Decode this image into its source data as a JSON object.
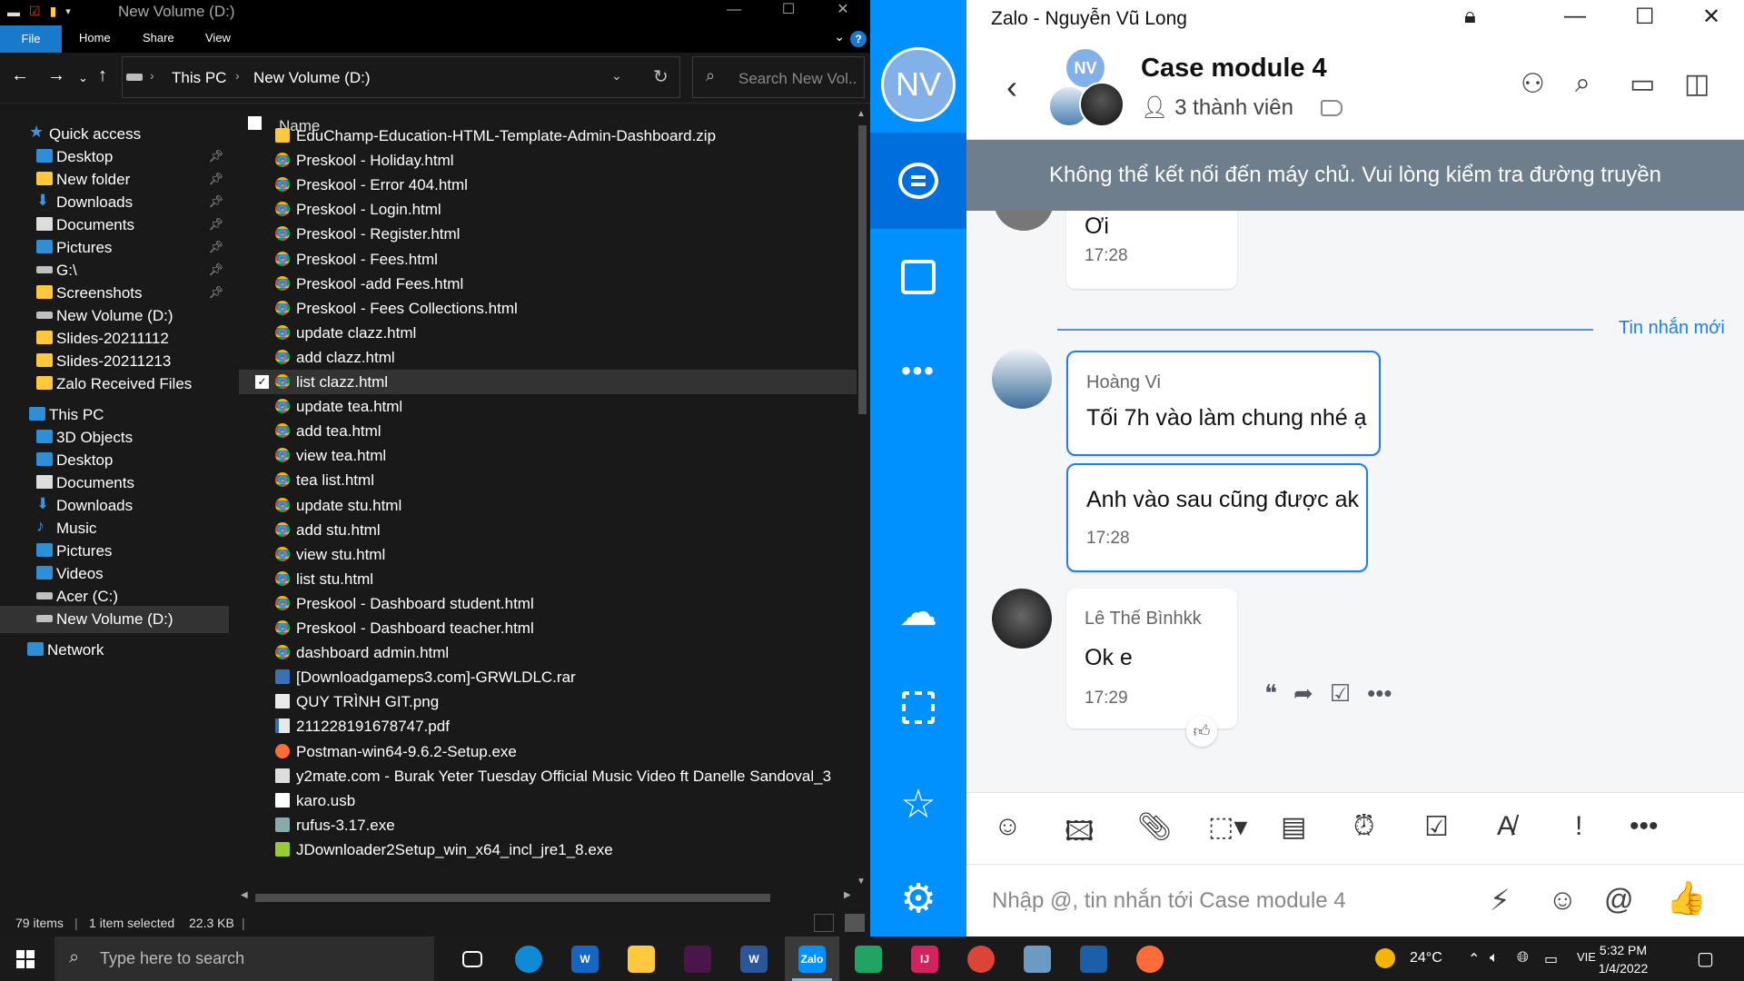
{
  "explorer": {
    "title": "New Volume (D:)",
    "ribbon_tabs": [
      "File",
      "Home",
      "Share",
      "View"
    ],
    "help_label": "?",
    "breadcrumb": [
      "This PC",
      "New Volume (D:)"
    ],
    "search_placeholder": "Search New Vol...",
    "nav": [
      {
        "label": "Quick access",
        "icon": "star-icon"
      },
      {
        "label": "Desktop",
        "icon": "desktop-icon",
        "pinned": true
      },
      {
        "label": "New folder",
        "icon": "folder-icon",
        "pinned": true
      },
      {
        "label": "Downloads",
        "icon": "download-arrow-icon",
        "pinned": true
      },
      {
        "label": "Documents",
        "icon": "documents-icon",
        "pinned": true
      },
      {
        "label": "Pictures",
        "icon": "pictures-icon",
        "pinned": true
      },
      {
        "label": "G:\\",
        "icon": "drive-icon",
        "pinned": true
      },
      {
        "label": "Screenshots",
        "icon": "folder-icon",
        "pinned": true
      },
      {
        "label": "New Volume (D:)",
        "icon": "drive-icon"
      },
      {
        "label": "Slides-20211112",
        "icon": "folder-icon"
      },
      {
        "label": "Slides-20211213",
        "icon": "folder-icon"
      },
      {
        "label": "Zalo Received Files",
        "icon": "folder-icon"
      },
      {
        "label": "This PC",
        "icon": "pc-icon"
      },
      {
        "label": "3D Objects",
        "icon": "3d-objects-icon"
      },
      {
        "label": "Desktop",
        "icon": "desktop-icon"
      },
      {
        "label": "Documents",
        "icon": "documents-icon"
      },
      {
        "label": "Downloads",
        "icon": "download-arrow-icon"
      },
      {
        "label": "Music",
        "icon": "music-icon"
      },
      {
        "label": "Pictures",
        "icon": "pictures-icon"
      },
      {
        "label": "Videos",
        "icon": "videos-icon"
      },
      {
        "label": "Acer (C:)",
        "icon": "drive-icon"
      },
      {
        "label": "New Volume (D:)",
        "icon": "drive-icon",
        "selected": true
      },
      {
        "label": "Network",
        "icon": "network-icon"
      }
    ],
    "column_name": "Name",
    "files": [
      {
        "name": "EduChamp-Education-HTML-Template-Admin-Dashboard.zip",
        "type": "zip"
      },
      {
        "name": "Preskool - Holiday.html",
        "type": "chrome"
      },
      {
        "name": "Preskool - Error 404.html",
        "type": "chrome"
      },
      {
        "name": "Preskool - Login.html",
        "type": "chrome"
      },
      {
        "name": "Preskool - Register.html",
        "type": "chrome"
      },
      {
        "name": "Preskool - Fees.html",
        "type": "chrome"
      },
      {
        "name": "Preskool -add Fees.html",
        "type": "chrome"
      },
      {
        "name": "Preskool - Fees Collections.html",
        "type": "chrome"
      },
      {
        "name": "update clazz.html",
        "type": "chrome"
      },
      {
        "name": "add clazz.html",
        "type": "chrome"
      },
      {
        "name": "list clazz.html",
        "type": "chrome",
        "selected": true
      },
      {
        "name": "update tea.html",
        "type": "chrome"
      },
      {
        "name": "add tea.html",
        "type": "chrome"
      },
      {
        "name": "view tea.html",
        "type": "chrome"
      },
      {
        "name": "tea list.html",
        "type": "chrome"
      },
      {
        "name": "update stu.html",
        "type": "chrome"
      },
      {
        "name": "add stu.html",
        "type": "chrome"
      },
      {
        "name": "view stu.html",
        "type": "chrome"
      },
      {
        "name": "list stu.html",
        "type": "chrome"
      },
      {
        "name": "Preskool - Dashboard student.html",
        "type": "chrome"
      },
      {
        "name": "Preskool - Dashboard teacher.html",
        "type": "chrome"
      },
      {
        "name": "dashboard admin.html",
        "type": "chrome"
      },
      {
        "name": "[Downloadgameps3.com]-GRWLDLC.rar",
        "type": "rar"
      },
      {
        "name": "QUY TRÌNH GIT.png",
        "type": "png"
      },
      {
        "name": "211228191678747.pdf",
        "type": "pdf"
      },
      {
        "name": "Postman-win64-9.6.2-Setup.exe",
        "type": "postman"
      },
      {
        "name": "y2mate.com - Burak Yeter  Tuesday Official Music Video ft Danelle Sandoval_3",
        "type": "video"
      },
      {
        "name": "karo.usb",
        "type": "usb"
      },
      {
        "name": "rufus-3.17.exe",
        "type": "rufus"
      },
      {
        "name": "JDownloader2Setup_win_x64_incl_jre1_8.exe",
        "type": "jd"
      }
    ],
    "status": {
      "items": "79 items",
      "selected": "1 item selected",
      "size": "22.3 KB"
    }
  },
  "zalo": {
    "window_title": "Zalo - Nguyễn Vũ Long",
    "user_initials": "NV",
    "group_initials": "NV",
    "chat_name": "Case module 4",
    "members": "3 thành viên",
    "banner": "Không thể kết nối đến máy chủ. Vui lòng kiểm tra đường truyền",
    "divider_label": "Tin nhắn mới",
    "messages": [
      {
        "sender": "",
        "text": "Ơi",
        "time": "17:28"
      },
      {
        "sender": "Hoàng Vi",
        "text": "Tối 7h vào làm chung nhé ạ",
        "time": ""
      },
      {
        "sender": "",
        "text": "Anh vào sau cũng được ak",
        "time": "17:28"
      },
      {
        "sender": "Lê Thế Bìnhkk",
        "text": "Ok e",
        "time": "17:29"
      }
    ],
    "input_placeholder": "Nhập @, tin nhắn tới Case module 4",
    "accent_color": "#0091ff"
  },
  "taskbar": {
    "search_placeholder": "Type here to search",
    "weather": "24°C",
    "language": "VIE",
    "time": "5:32 PM",
    "date": "1/4/2022",
    "apps": [
      {
        "name": "task-view",
        "label": ""
      },
      {
        "name": "edge",
        "label": ""
      },
      {
        "name": "wps",
        "label": "W"
      },
      {
        "name": "file-explorer",
        "label": ""
      },
      {
        "name": "slack",
        "label": ""
      },
      {
        "name": "word",
        "label": "W"
      },
      {
        "name": "zalo",
        "label": "Zalo"
      },
      {
        "name": "google-drive",
        "label": ""
      },
      {
        "name": "intellij",
        "label": "IJ"
      },
      {
        "name": "chrome",
        "label": ""
      },
      {
        "name": "notepad",
        "label": ""
      },
      {
        "name": "wireshark",
        "label": ""
      },
      {
        "name": "postman",
        "label": ""
      }
    ]
  }
}
